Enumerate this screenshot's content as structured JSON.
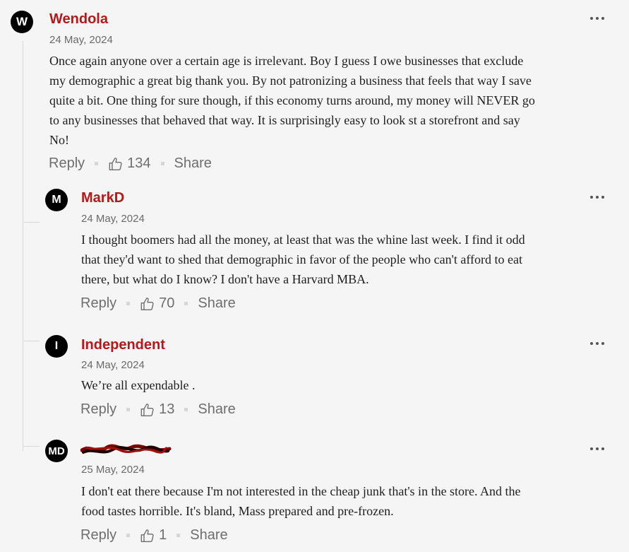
{
  "comments": [
    {
      "avatar_initials": "W",
      "author": "Wendola",
      "date": "24 May, 2024",
      "lines": [
        "Once again anyone over a certain age is irrelevant. Boy I guess I owe businesses that exclude",
        "my demographic a great big thank you. By not patronizing a business that feels that way I save",
        "quite a bit. One thing for sure though, if this economy  turns around, my money will NEVER go",
        "to any businesses that behaved that way. It is surprisingly easy to look st a storefront and say",
        "No!"
      ],
      "reply_label": "Reply",
      "like_count": "134",
      "share_label": "Share"
    },
    {
      "avatar_initials": "M",
      "author": "MarkD",
      "date": "24 May, 2024",
      "lines": [
        "I thought boomers had all the money, at least that was the whine last week.   I find it odd",
        "that they'd want to shed that demographic in favor of the people who can't afford to eat",
        "there, but what do I know?  I don't have a Harvard MBA."
      ],
      "reply_label": "Reply",
      "like_count": "70",
      "share_label": "Share"
    },
    {
      "avatar_initials": "I",
      "author": "Independent",
      "date": "24 May, 2024",
      "lines": [
        "We’re all expendable ."
      ],
      "reply_label": "Reply",
      "like_count": "13",
      "share_label": "Share"
    },
    {
      "avatar_initials": "MD",
      "author": "",
      "author_redacted": true,
      "date": "25 May, 2024",
      "lines": [
        "I don't eat there because I'm not interested in the cheap junk that's in the store. And the",
        "food tastes horrible. It's bland, Mass prepared and pre-frozen."
      ],
      "reply_label": "Reply",
      "like_count": "1",
      "share_label": "Share"
    }
  ],
  "icons": {
    "like": "thumbs-up-icon",
    "more": "more-options-icon"
  },
  "colors": {
    "author": "#b3191b",
    "background": "#f5f5f5",
    "text": "#1e1e1e",
    "meta": "#6a6a6a",
    "redaction": "#7a0000"
  }
}
